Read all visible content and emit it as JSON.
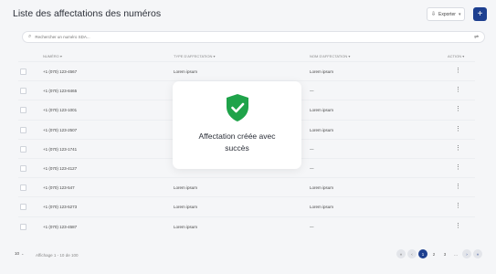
{
  "page": {
    "title": "Liste des affectations des numéros"
  },
  "toolbar": {
    "export_label": "Exporter",
    "add_label": "+"
  },
  "search": {
    "placeholder": "Rechercher un numéro SDA..."
  },
  "table": {
    "headers": {
      "number": "NUMÉRO ▾",
      "type": "TYPE D'AFFECTATION ▾",
      "name": "NOM D'AFFECTATION ▾",
      "action": "ACTION ▾"
    },
    "rows": [
      {
        "number": "+1 (070) 123-4567",
        "type": "Lorem ipsum",
        "name": "Lorem ipsum"
      },
      {
        "number": "+1 (070) 123-8465",
        "type": "",
        "name": "—"
      },
      {
        "number": "+1 (070) 123-1001",
        "type": "",
        "name": "Lorem ipsum"
      },
      {
        "number": "+1 (070) 123-2507",
        "type": "",
        "name": "Lorem ipsum"
      },
      {
        "number": "+1 (070) 123-1741",
        "type": "",
        "name": "—"
      },
      {
        "number": "+1 (070) 123-4127",
        "type": "",
        "name": "—"
      },
      {
        "number": "+1 (070) 123-547",
        "type": "Lorem ipsum",
        "name": "Lorem ipsum"
      },
      {
        "number": "+1 (070) 123-5273",
        "type": "Lorem ipsum",
        "name": "Lorem ipsum"
      },
      {
        "number": "+1 (070) 123-4587",
        "type": "Lorem ipsum",
        "name": "—"
      }
    ]
  },
  "modal": {
    "message": "Affectation  créée avec succès"
  },
  "footer": {
    "per_page": "10",
    "info": "Affichage 1 - 10 de 100",
    "pages": [
      "«",
      "‹",
      "1",
      "2",
      "3",
      "...",
      "›",
      "»"
    ]
  },
  "colors": {
    "accent": "#1d3f8f",
    "success": "#1fa34a"
  },
  "icons": {
    "export": "export-icon",
    "search": "search-icon",
    "filter": "filter-icon",
    "shield": "shield-check-icon",
    "menu": "more-vertical-icon"
  }
}
